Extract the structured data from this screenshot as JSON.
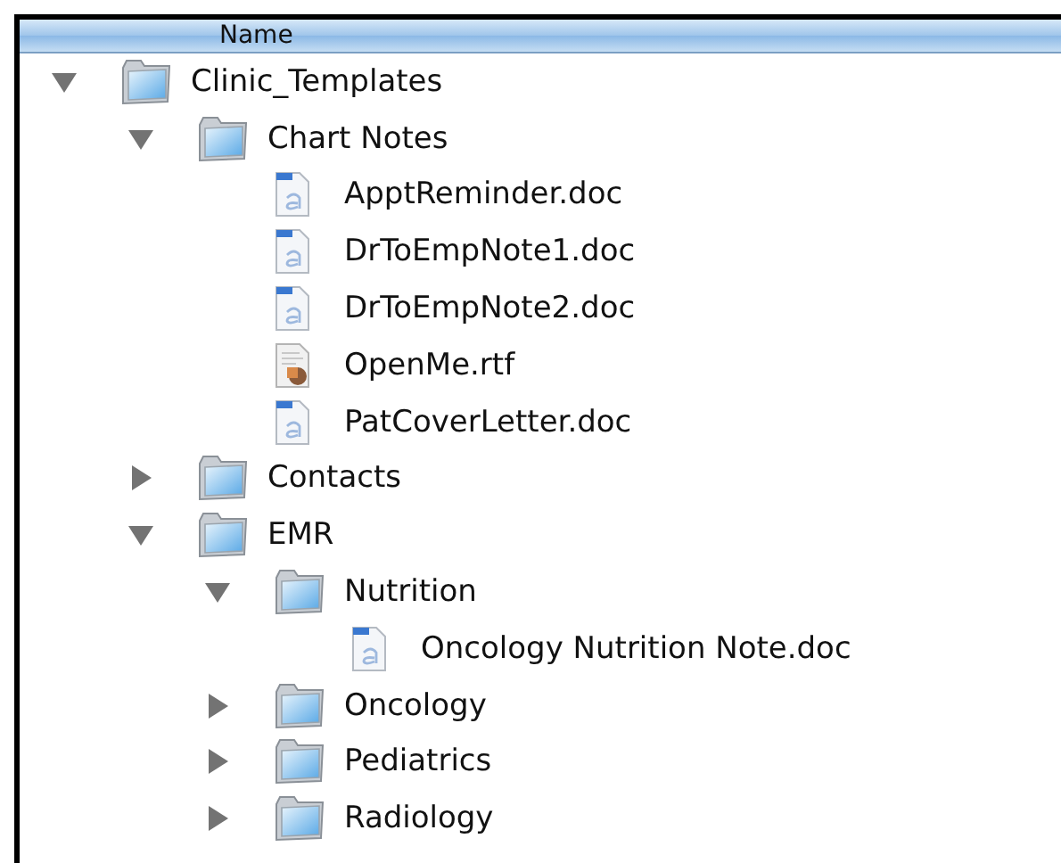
{
  "header": {
    "column": "Name"
  },
  "tree": [
    {
      "name": "Clinic_Templates",
      "kind": "folder",
      "expanded": true,
      "children": [
        {
          "name": "Chart Notes",
          "kind": "folder",
          "expanded": true,
          "children": [
            {
              "name": "ApptReminder.doc",
              "kind": "doc"
            },
            {
              "name": "DrToEmpNote1.doc",
              "kind": "doc"
            },
            {
              "name": "DrToEmpNote2.doc",
              "kind": "doc"
            },
            {
              "name": "OpenMe.rtf",
              "kind": "rtf"
            },
            {
              "name": "PatCoverLetter.doc",
              "kind": "doc"
            }
          ]
        },
        {
          "name": "Contacts",
          "kind": "folder",
          "expanded": false
        },
        {
          "name": "EMR",
          "kind": "folder",
          "expanded": true,
          "children": [
            {
              "name": "Nutrition",
              "kind": "folder",
              "expanded": true,
              "children": [
                {
                  "name": "Oncology Nutrition Note.doc",
                  "kind": "doc"
                }
              ]
            },
            {
              "name": "Oncology",
              "kind": "folder",
              "expanded": false
            },
            {
              "name": "Pediatrics",
              "kind": "folder",
              "expanded": false
            },
            {
              "name": "Radiology",
              "kind": "folder",
              "expanded": false
            }
          ]
        }
      ]
    }
  ]
}
